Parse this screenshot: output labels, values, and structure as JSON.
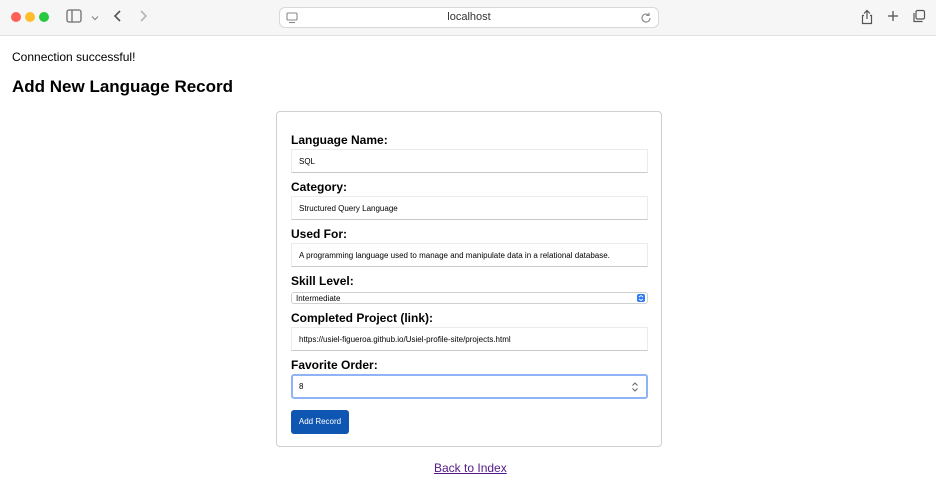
{
  "browser": {
    "url": "localhost",
    "icons": [
      "sidebar-icon",
      "chevron-down-icon",
      "back-arrow-icon",
      "forward-arrow-icon",
      "page-icon",
      "reload-icon",
      "share-icon",
      "new-tab-icon",
      "tabs-overview-icon"
    ]
  },
  "page": {
    "status": "Connection successful!",
    "heading": "Add New Language Record",
    "back_link": "Back to Index"
  },
  "form": {
    "language_name": {
      "label": "Language Name:",
      "value": "SQL"
    },
    "category": {
      "label": "Category:",
      "value": "Structured Query Language"
    },
    "used_for": {
      "label": "Used For:",
      "value": "A programming language used to manage and manipulate data in a relational database."
    },
    "skill_level": {
      "label": "Skill Level:",
      "value": "Intermediate"
    },
    "completed_project": {
      "label": "Completed Project (link):",
      "value": "https://usiel-figueroa.github.io/Usiel-profile-site/projects.html"
    },
    "favorite_order": {
      "label": "Favorite Order:",
      "value": "8"
    },
    "submit_label": "Add Record"
  },
  "colors": {
    "accent": "#0f56b3",
    "focus_ring": "#8fb3f5",
    "visited_link": "#551a8b"
  }
}
